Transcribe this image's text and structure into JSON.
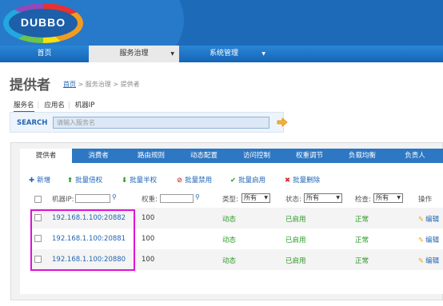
{
  "logo": {
    "text": "DUBBO"
  },
  "nav": {
    "items": [
      {
        "label": "首页"
      },
      {
        "label": "服务治理",
        "arrow": "▼"
      },
      {
        "label": "系统管理",
        "arrow": "▼"
      }
    ]
  },
  "page": {
    "title": "提供者",
    "breadcrumb": {
      "home": "首页",
      "rest": " > 服务治理 > 提供者"
    }
  },
  "subtabs": [
    "服务名",
    "应用名",
    "机器IP"
  ],
  "search": {
    "label": "SEARCH",
    "placeholder": "请输入服务名"
  },
  "tabs": [
    "提供者",
    "消费者",
    "路由规则",
    "动态配置",
    "访问控制",
    "权重调节",
    "负载均衡",
    "负责人"
  ],
  "actions": [
    {
      "icon": "✚",
      "label": "新增"
    },
    {
      "icon": "⬆",
      "label": "批量倍权"
    },
    {
      "icon": "⬇",
      "label": "批量半权"
    },
    {
      "icon": "⊘",
      "label": "批量禁用"
    },
    {
      "icon": "✔",
      "label": "批量启用"
    },
    {
      "icon": "✖",
      "label": "批量删除"
    }
  ],
  "filter": {
    "ip_label": "机器IP:",
    "weight_label": "权重:",
    "type_label": "类型:",
    "type_value": "所有",
    "status_label": "状态:",
    "status_value": "所有",
    "check_label": "检查:",
    "check_value": "所有",
    "op_label": "操作"
  },
  "rows": [
    {
      "ip": "192.168.1.100:20882",
      "weight": "100",
      "type": "动态",
      "status": "已启用",
      "check": "正常",
      "op": "编辑"
    },
    {
      "ip": "192.168.1.100:20881",
      "weight": "100",
      "type": "动态",
      "status": "已启用",
      "check": "正常",
      "op": "编辑"
    },
    {
      "ip": "192.168.1.100:20880",
      "weight": "100",
      "type": "动态",
      "status": "已启用",
      "check": "正常",
      "op": "编辑"
    }
  ],
  "colors": {
    "nav_blue": "#1d6ab8",
    "link": "#2166b4",
    "ok_green": "#2a9a24",
    "highlight": "#e010d8"
  }
}
